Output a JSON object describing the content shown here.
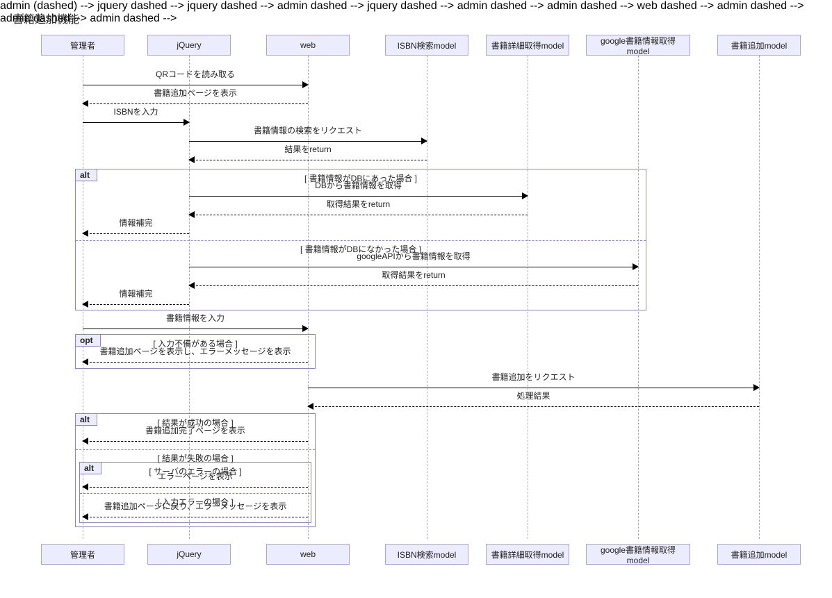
{
  "title": "書籍追加機能",
  "actors": {
    "admin": "管理者",
    "jquery": "jQuery",
    "web": "web",
    "isbn_model": "ISBN検索model",
    "detail_model": "書籍詳細取得model",
    "google_model": "google書籍情報取得model",
    "add_model": "書籍追加model"
  },
  "messages": {
    "m1": "QRコードを読み取る",
    "m2": "書籍追加ページを表示",
    "m3": "ISBNを入力",
    "m4": "書籍情報の検索をリクエスト",
    "m5": "結果をreturn",
    "m6": "DBから書籍情報を取得",
    "m7": "取得結果をreturn",
    "m8": "情報補完",
    "m9": "googleAPIから書籍情報を取得",
    "m10": "取得結果をreturn",
    "m11": "情報補完",
    "m12": "書籍情報を入力",
    "m13": "書籍追加ページを表示し、エラーメッセージを表示",
    "m14": "書籍追加をリクエスト",
    "m15": "処理結果",
    "m16": "書籍追加完了ページを表示",
    "m17": "エラーページを表示",
    "m18": "書籍追加ページに戻り、エラーメッセージを表示"
  },
  "frames": {
    "alt1_tag": "alt",
    "alt1_g1": "[ 書籍情報がDBにあった場合 ]",
    "alt1_g2": "[ 書籍情報がDBになかった場合 ]",
    "opt_tag": "opt",
    "opt_g": "[ 入力不備がある場合 ]",
    "alt2_tag": "alt",
    "alt2_g1": "[ 結果が成功の場合 ]",
    "alt2_g2": "[ 結果が失敗の場合 ]",
    "alt3_tag": "alt",
    "alt3_g1": "[ サーバのエラーの場合 ]",
    "alt3_g2": "[ 入力エラーの場合 ]"
  }
}
